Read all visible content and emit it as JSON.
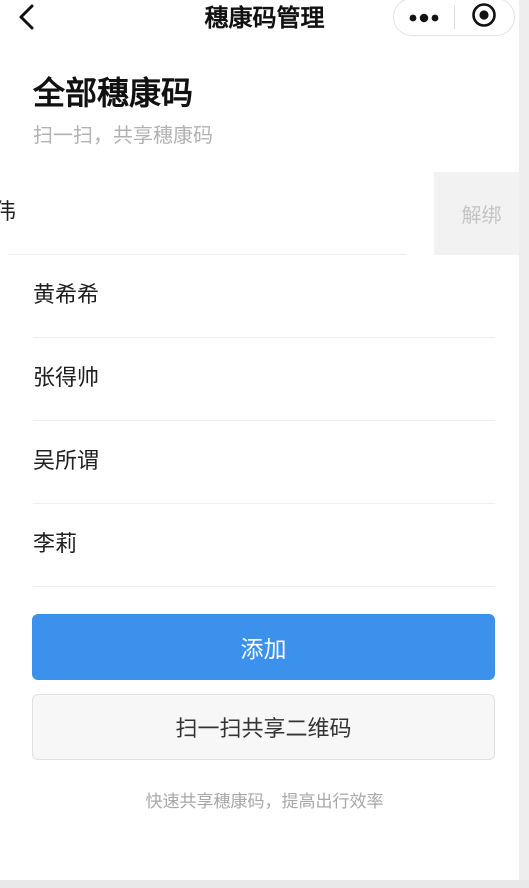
{
  "navbar": {
    "title": "穗康码管理"
  },
  "header": {
    "title": "全部穗康码",
    "subtitle": "扫一扫，共享穗康码"
  },
  "list": {
    "swiped_item": {
      "name_partial": "伟",
      "unbind_label": "解绑"
    },
    "items": [
      {
        "name": "黄希希"
      },
      {
        "name": "张得帅"
      },
      {
        "name": "吴所谓"
      },
      {
        "name": "李莉"
      }
    ]
  },
  "actions": {
    "add_label": "添加",
    "scan_share_label": "扫一扫共享二维码"
  },
  "footer": {
    "tip": "快速共享穗康码，提高出行效率"
  },
  "colors": {
    "primary": "#3c91ec",
    "muted_text": "#b2b2b2"
  }
}
